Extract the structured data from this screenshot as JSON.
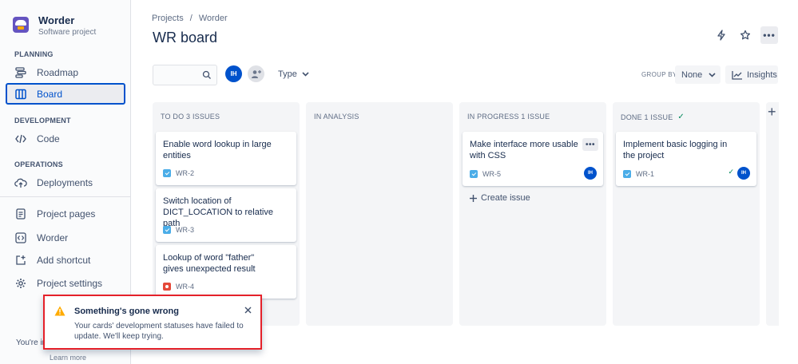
{
  "sidebar": {
    "project_name": "Worder",
    "project_type": "Software project",
    "sections": {
      "planning": "PLANNING",
      "development": "DEVELOPMENT",
      "operations": "OPERATIONS"
    },
    "items": {
      "roadmap": "Roadmap",
      "board": "Board",
      "code": "Code",
      "deployments": "Deployments",
      "project_pages": "Project pages",
      "worder": "Worder",
      "add_shortcut": "Add shortcut",
      "project_settings": "Project settings"
    },
    "footer_text": "You're in",
    "learn_more": "Learn more"
  },
  "header": {
    "breadcrumb": [
      "Projects",
      "/",
      "Worder"
    ],
    "title": "WR board"
  },
  "toolbar": {
    "search_value": "",
    "avatar_initials": "IH",
    "type_filter": "Type",
    "group_by_label": "GROUP BY",
    "group_by_value": "None",
    "insights_label": "Insights"
  },
  "columns": [
    {
      "title": "TO DO 3 ISSUES",
      "cards": [
        {
          "summary": "Enable word lookup in large entities",
          "key": "WR-2",
          "type": "task"
        },
        {
          "summary": "Switch location of DICT_LOCATION to relative path",
          "key": "WR-3",
          "type": "task"
        },
        {
          "summary": "Lookup of word \"father\" gives unexpected result",
          "key": "WR-4",
          "type": "bug"
        }
      ]
    },
    {
      "title": "IN ANALYSIS",
      "cards": []
    },
    {
      "title": "IN PROGRESS 1 ISSUE",
      "cards": [
        {
          "summary": "Make interface more usable with CSS",
          "key": "WR-5",
          "type": "task",
          "assignee": "IH"
        }
      ],
      "create_label": "Create issue"
    },
    {
      "title": "DONE 1 ISSUE",
      "cards": [
        {
          "summary": "Implement basic logging in the project",
          "key": "WR-1",
          "type": "task",
          "assignee": "IH",
          "done": true
        }
      ]
    }
  ],
  "flag": {
    "title": "Something's gone wrong",
    "message": "Your cards' development statuses have failed to update. We'll keep trying."
  },
  "colors": {
    "primary": "#0052cc",
    "column_bg": "#f4f5f7",
    "error_border": "#e5212a",
    "warning": "#ffab00",
    "success": "#00875a"
  }
}
